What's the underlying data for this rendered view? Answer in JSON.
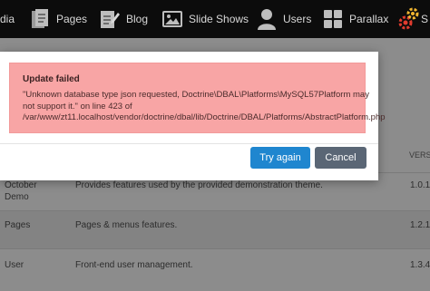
{
  "navbar": {
    "items": [
      {
        "label": "dia",
        "icon": "media-icon"
      },
      {
        "label": "Pages",
        "icon": "pages-icon"
      },
      {
        "label": "Blog",
        "icon": "blog-icon"
      },
      {
        "label": "Slide Shows",
        "icon": "image-icon"
      },
      {
        "label": "Users",
        "icon": "user-icon"
      },
      {
        "label": "Parallax",
        "icon": "grid-icon"
      },
      {
        "label": "S",
        "icon": "settings-icon"
      }
    ]
  },
  "table": {
    "version_header": "VERS",
    "rows": [
      {
        "name": "October Demo",
        "description": "Provides features used by the provided demonstration theme.",
        "version": "1.0.1"
      },
      {
        "name": "Pages",
        "description": "Pages & menus features.",
        "version": "1.2.1"
      },
      {
        "name": "User",
        "description": "Front-end user management.",
        "version": "1.3.4"
      }
    ]
  },
  "modal": {
    "title": "Update failed",
    "message": "\"Unknown database type json requested, Doctrine\\DBAL\\Platforms\\MySQL57Platform may not support it.\" on line 423 of /var/www/zt11.localhost/vendor/doctrine/dbal/lib/Doctrine/DBAL/Platforms/AbstractPlatform.php",
    "try_again_label": "Try again",
    "cancel_label": "Cancel"
  },
  "colors": {
    "navbar_bg": "#0c0c0c",
    "alert_bg": "#f8a5a5",
    "primary_button": "#1f86cf",
    "secondary_button": "#5a6675",
    "settings_icon_red": "#e03b2e",
    "settings_icon_yellow": "#f2b630"
  }
}
